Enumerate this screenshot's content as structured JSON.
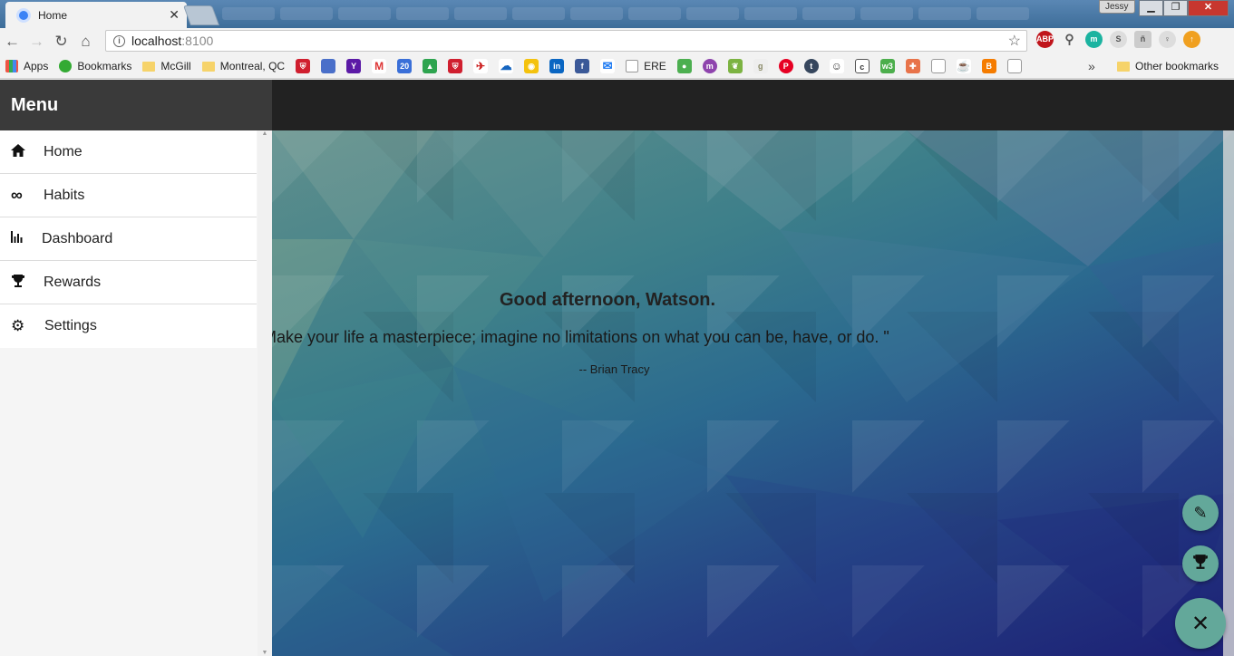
{
  "browser": {
    "tab_title": "Home",
    "tab_close": "✕",
    "user": "Jessy",
    "url_host": "localhost",
    "url_port": ":8100",
    "bookmarks": {
      "apps": "Apps",
      "bookmarks": "Bookmarks",
      "mcgill": "McGill",
      "montreal": "Montreal, QC",
      "ere": "ERE",
      "more": "»",
      "other": "Other bookmarks"
    }
  },
  "app": {
    "menu_title": "Menu",
    "menu_items": [
      {
        "label": "Home",
        "icon": "home-icon"
      },
      {
        "label": "Habits",
        "icon": "infinity-icon"
      },
      {
        "label": "Dashboard",
        "icon": "bar-chart-icon"
      },
      {
        "label": "Rewards",
        "icon": "trophy-icon"
      },
      {
        "label": "Settings",
        "icon": "gear-icon"
      }
    ],
    "greeting": "Good afternoon, Watson.",
    "quote": "Make your life a masterpiece; imagine no limitations on what you can be, have, or do. \"",
    "author": "-- Brian Tracy",
    "fab_color": "#63a89a"
  }
}
